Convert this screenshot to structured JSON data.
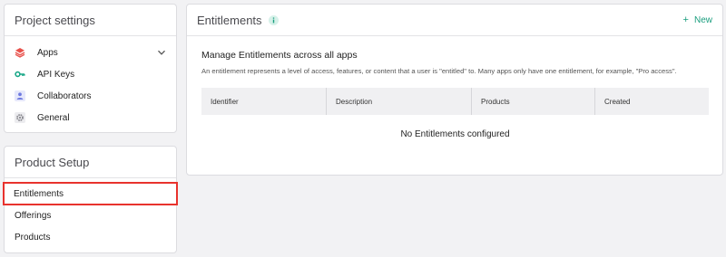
{
  "project_settings": {
    "title": "Project settings",
    "items": [
      {
        "label": "Apps",
        "icon": "stack-icon",
        "color": "#e8504a"
      },
      {
        "label": "API Keys",
        "icon": "key-icon",
        "color": "#1aa888"
      },
      {
        "label": "Collaborators",
        "icon": "person-icon",
        "color": "#6f7be0"
      },
      {
        "label": "General",
        "icon": "gear-icon",
        "color": "#8a8a90"
      }
    ]
  },
  "product_setup": {
    "title": "Product Setup",
    "items": [
      {
        "label": "Entitlements"
      },
      {
        "label": "Offerings"
      },
      {
        "label": "Products"
      }
    ],
    "highlight_color": "#e8322d"
  },
  "entitlements": {
    "title": "Entitlements",
    "new_label": "New",
    "heading": "Manage Entitlements across all apps",
    "description": "An entitlement represents a level of access, features, or content that a user is \"entitled\" to. Many apps only have one entitlement, for example, \"Pro access\".",
    "columns": [
      "Identifier",
      "Description",
      "Products",
      "Created"
    ],
    "empty_message": "No Entitlements configured",
    "accent_color": "#1a9e7e"
  }
}
